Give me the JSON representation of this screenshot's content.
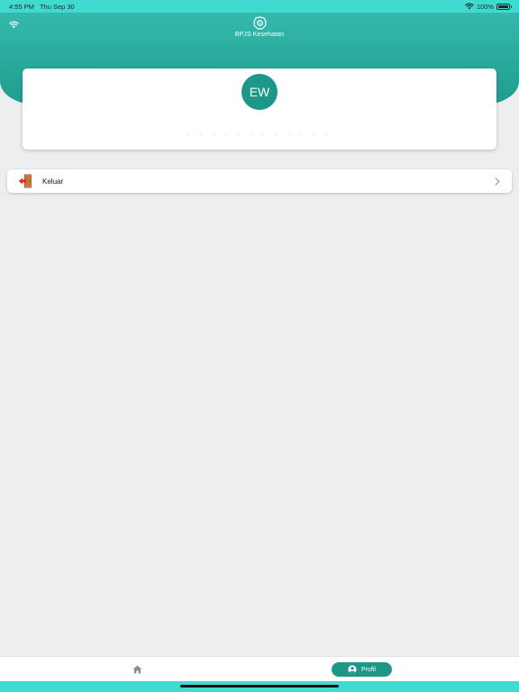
{
  "status_bar": {
    "time": "4:55 PM",
    "date": "Thu Sep 30",
    "battery_percent": "100%",
    "battery_level": 1.0
  },
  "header": {
    "brand_name": "BPJS Kesehatan",
    "status_icon": "wifi-icon",
    "logo_icon": "bpjs-logo-icon"
  },
  "profile": {
    "initials": "EW",
    "name_obscured": ". . . . . . . . . . . ."
  },
  "menu": {
    "items": [
      {
        "label": "Keluar",
        "icon": "logout-door-icon",
        "chevron": "chevron-right-icon"
      }
    ]
  },
  "bottom_nav": {
    "home_icon": "home-icon",
    "profil_label": "Profil",
    "profil_icon": "user-circle-icon"
  },
  "colors": {
    "status_bar": "#3fdad0",
    "header_top": "#35b9ac",
    "header_bottom": "#1f9d8d",
    "accent": "#1d9888",
    "background": "#eceef0",
    "logout_arrow": "#d32f2f",
    "door": "#c8763a"
  }
}
